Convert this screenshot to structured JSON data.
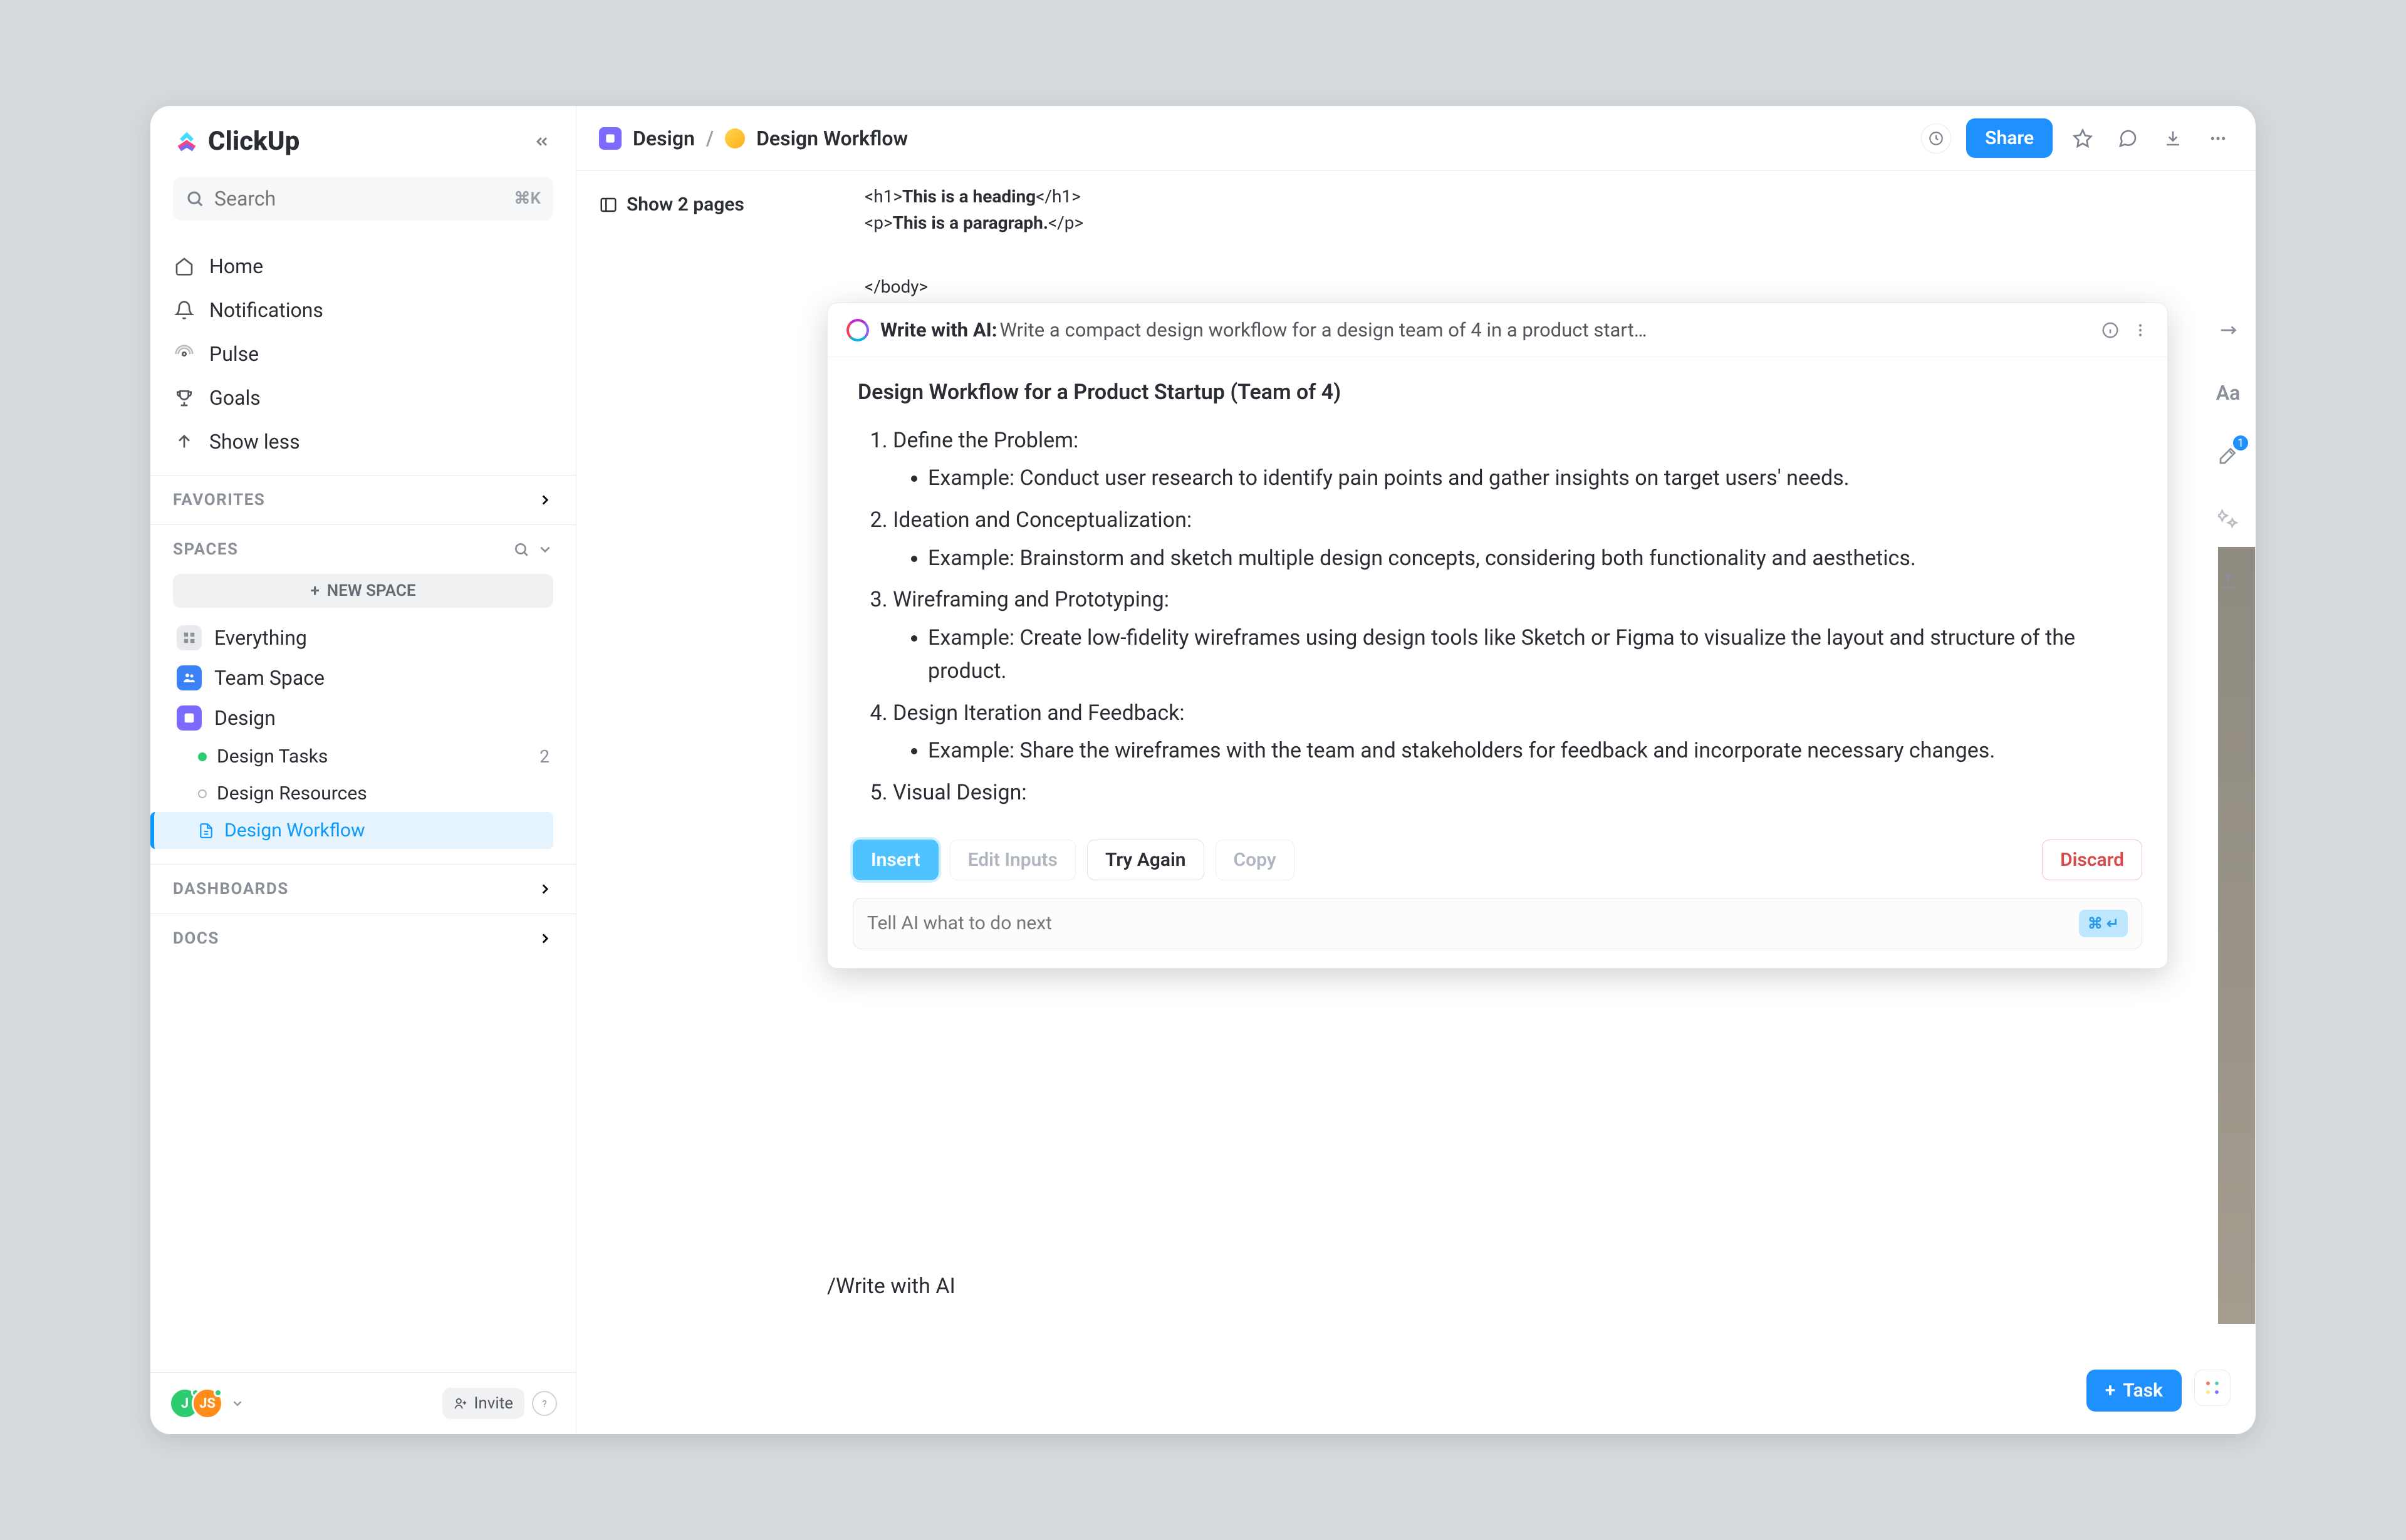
{
  "brand": "ClickUp",
  "search": {
    "placeholder": "Search",
    "shortcut": "⌘K"
  },
  "nav": {
    "home": "Home",
    "notifications": "Notifications",
    "pulse": "Pulse",
    "goals": "Goals",
    "showless": "Show less"
  },
  "sections": {
    "favorites": "FAVORITES",
    "spaces": "SPACES",
    "dashboards": "DASHBOARDS",
    "docs": "DOCS",
    "new_space": "NEW SPACE"
  },
  "spaces": {
    "everything": "Everything",
    "team": "Team Space",
    "design": "Design",
    "children": [
      {
        "label": "Design Tasks",
        "count": "2",
        "style": "green"
      },
      {
        "label": "Design Resources",
        "style": "hollow"
      },
      {
        "label": "Design Workflow",
        "style": "doc",
        "active": true
      }
    ]
  },
  "avatars": {
    "j": "J",
    "js": "JS"
  },
  "invite": "Invite",
  "breadcrumb": {
    "a": "Design",
    "b": "Design Workflow"
  },
  "topbar": {
    "share": "Share"
  },
  "show_pages": "Show 2 pages",
  "code": {
    "l1a": "<h1>",
    "l1b": "This is a heading",
    "l1c": "</h1>",
    "l2a": "<p>",
    "l2b": "This is a paragraph.",
    "l2c": "</p>",
    "l3": "</body>"
  },
  "ai": {
    "label": "Write with AI:",
    "prompt": "Write a compact design workflow for a design team of 4 in a product start…",
    "heading": "Design Workflow for a Product Startup (Team of 4)",
    "items": [
      {
        "t": "Define the Problem:",
        "ex": "Example: Conduct user research to identify pain points and gather insights on target users' needs."
      },
      {
        "t": "Ideation and Conceptualization:",
        "ex": "Example: Brainstorm and sketch multiple design concepts, considering both functionality and aesthetics."
      },
      {
        "t": "Wireframing and Prototyping:",
        "ex": "Example: Create low-fidelity wireframes using design tools like Sketch or Figma to visualize the layout and structure of the product."
      },
      {
        "t": "Design Iteration and Feedback:",
        "ex": "Example: Share the wireframes with the team and stakeholders for feedback and incorporate necessary changes."
      },
      {
        "t": "Visual Design:",
        "ex": ""
      }
    ],
    "actions": {
      "insert": "Insert",
      "edit": "Edit Inputs",
      "try": "Try Again",
      "copy": "Copy",
      "discard": "Discard"
    },
    "next_placeholder": "Tell AI what to do next",
    "chip": "⌘ ↵"
  },
  "slash": "/Write with AI",
  "rr": {
    "badge": "1",
    "aa": "Aa"
  },
  "task_btn": "Task"
}
